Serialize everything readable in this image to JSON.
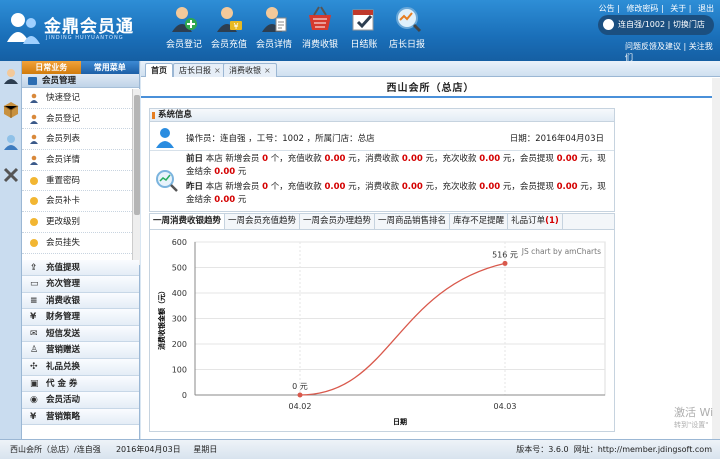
{
  "header": {
    "logo_title": "金鼎会员通",
    "logo_subtitle": "JINDING HUIYUANTONG",
    "nav": [
      {
        "label": "会员登记",
        "icon": "user-add-icon"
      },
      {
        "label": "会员充值",
        "icon": "user-money-icon"
      },
      {
        "label": "会员详情",
        "icon": "user-info-icon"
      },
      {
        "label": "消费收银",
        "icon": "basket-icon"
      },
      {
        "label": "日结账",
        "icon": "calendar-check-icon"
      },
      {
        "label": "店长日报",
        "icon": "report-search-icon"
      }
    ],
    "top_links": [
      "公告",
      "修改密码",
      "关于",
      "退出"
    ],
    "user": "连自强/1002",
    "switch_store": "切换门店",
    "feedback": "问题反馈及建议",
    "follow": "关注我们"
  },
  "sidebar": {
    "tabs": [
      "日常业务",
      "常用菜单"
    ],
    "section_title": "会员管理",
    "items": [
      "快速登记",
      "会员登记",
      "会员列表",
      "会员详情",
      "重置密码",
      "会员补卡",
      "更改级别",
      "会员挂失"
    ],
    "categories": [
      "充值提现",
      "充次管理",
      "消费收银",
      "财务管理",
      "短信发送",
      "营销赠送",
      "礼品兑换",
      "代 金 券",
      "会员活动",
      "营销策略"
    ]
  },
  "tabs": [
    {
      "label": "首页",
      "active": true,
      "closable": false
    },
    {
      "label": "店长日报",
      "active": false,
      "closable": true
    },
    {
      "label": "消费收银",
      "active": false,
      "closable": true
    }
  ],
  "page_title": "西山会所（总店）",
  "system_info": {
    "title": "系统信息",
    "operator_label": "操作员：",
    "operator": "连自强",
    "jobno_label": "工号：",
    "jobno": "1002",
    "store_label": "所属门店：",
    "store": "总店",
    "date_label": "日期：",
    "date": "2016年04月03日",
    "before_label": "前日",
    "yesterday_label": "昨日",
    "before": {
      "new_members": "0",
      "recharge": "0.00",
      "consume": "0.00",
      "count_recharge": "0.00",
      "withdraw": "0.00",
      "cash": "0.00"
    },
    "yesterday": {
      "new_members": "0",
      "recharge": "0.00",
      "consume": "0.00",
      "count_recharge": "0.00",
      "withdraw": "0.00",
      "cash": "0.00"
    },
    "text": {
      "p1": "本店 新增会员 ",
      "p2": " 个，充值收款 ",
      "p3": " 元，消费收款 ",
      "p4": " 元，充次收款 ",
      "p5": " 元，会员提现 ",
      "p6": " 元，现",
      "p7": "金结余 ",
      "p8": " 元"
    }
  },
  "chart_tabs": [
    "一周消费收银趋势",
    "一周会员充值趋势",
    "一周会员办理趋势",
    "一周商品销售排名",
    "库存不足提醒",
    "礼品订单",
    "(1)"
  ],
  "chart_data": {
    "type": "line",
    "x": [
      "04.02",
      "04.03"
    ],
    "values": [
      0,
      516
    ],
    "data_labels": [
      "0 元",
      "516 元"
    ],
    "ylabel": "消费收银金额（元）",
    "xlabel": "日期",
    "ylim": [
      0,
      600
    ],
    "yticks": [
      0,
      100,
      200,
      300,
      400,
      500,
      600
    ],
    "credit": "JS chart by amCharts",
    "line_color": "#d9594c",
    "grid": true
  },
  "footer": {
    "store_user": "西山会所（总店）/连自强",
    "date": "2016年04月03日",
    "weekday": "星期日",
    "version_label": "版本号：",
    "version": "3.6.0",
    "site_label": "网址：",
    "site": "http://member.jdingsoft.com"
  },
  "watermark": {
    "line1": "激活 Wi",
    "line2": "转到\"设置\""
  }
}
